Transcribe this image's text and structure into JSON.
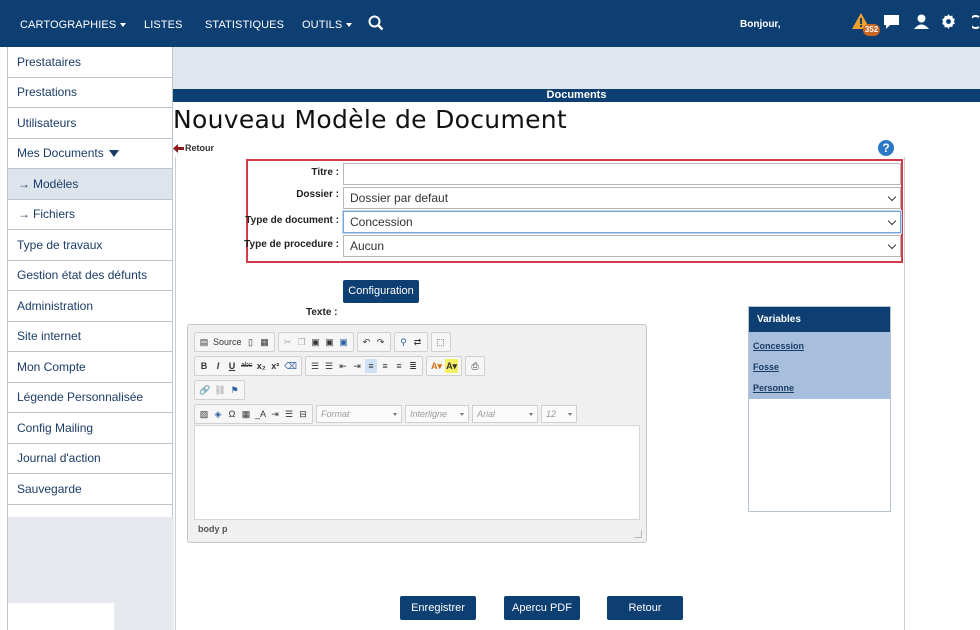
{
  "topbar": {
    "menu": [
      {
        "label": "CARTOGRAPHIES",
        "dropdown": true
      },
      {
        "label": "LISTES",
        "dropdown": false
      },
      {
        "label": "STATISTIQUES",
        "dropdown": false
      },
      {
        "label": "OUTILS",
        "dropdown": true
      }
    ],
    "greeting": "Bonjour,",
    "alert_count": "352",
    "icons": [
      "search-icon",
      "warning-icon",
      "chat-icon",
      "user-icon",
      "gear-icon"
    ]
  },
  "sidebar": {
    "items": [
      {
        "label": "Prestataires"
      },
      {
        "label": "Prestations"
      },
      {
        "label": "Utilisateurs"
      },
      {
        "label": "Mes Documents"
      },
      {
        "label": "Modèles"
      },
      {
        "label": "Fichiers"
      },
      {
        "label": "Type de travaux"
      },
      {
        "label": "Gestion état des défunts"
      },
      {
        "label": "Administration"
      },
      {
        "label": "Site internet"
      },
      {
        "label": "Mon Compte"
      },
      {
        "label": "Légende Personnalisée"
      },
      {
        "label": "Config Mailing"
      },
      {
        "label": "Journal d'action"
      },
      {
        "label": "Sauvegarde"
      }
    ]
  },
  "section_title": "Documents",
  "page_title": "Nouveau Modèle de Document",
  "back_label": "Retour",
  "form": {
    "titre_label": "Titre :",
    "titre_value": "",
    "dossier_label": "Dossier :",
    "dossier_value": "Dossier par defaut",
    "type_doc_label": "Type de document :",
    "type_doc_value": "Concession",
    "type_proc_label": "Type de procedure :",
    "type_proc_value": "Aucun"
  },
  "config_button": "Configuration",
  "texte_label": "Texte :",
  "editor": {
    "source_label": "Source",
    "format_label": "Format",
    "interligne_label": "Interligne",
    "font_label": "Arial",
    "size_label": "12",
    "status_path": "body  p"
  },
  "variables": {
    "title": "Variables",
    "items": [
      "Concession",
      "Fosse",
      "Personne"
    ]
  },
  "buttons": {
    "save": "Enregistrer",
    "preview": "Apercu PDF",
    "back": "Retour"
  },
  "colors": {
    "primary": "#0e3f73",
    "highlight_border": "#d43a4a",
    "variables_bg": "#a7bfdc"
  }
}
